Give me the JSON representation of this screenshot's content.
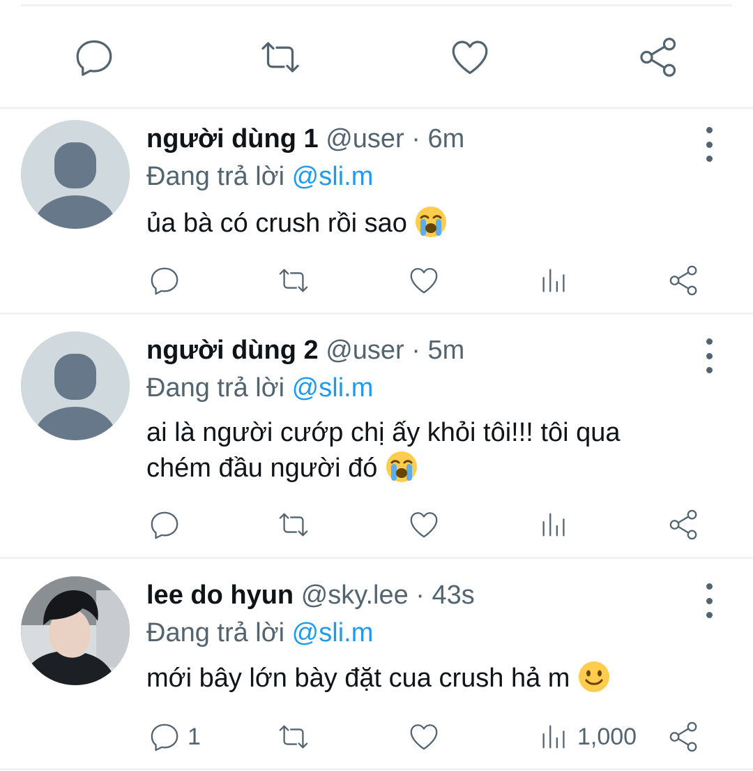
{
  "replying_prefix": "Đang trả lời",
  "icons": {
    "reply": "comment-bubble-icon",
    "retweet": "retweet-icon",
    "like": "heart-icon",
    "views": "bar-chart-icon",
    "share": "share-icon",
    "more": "more-vertical-icon"
  },
  "colors": {
    "accent": "#1d9bf0",
    "muted": "#536471",
    "divider": "#eff1f3"
  },
  "replies": [
    {
      "name": "người dùng 1",
      "handle": "@user",
      "dot": "·",
      "time": "6m",
      "replying_to": "@sli.m",
      "text": "ủa bà có crush rồi sao",
      "emoji": "loudly-crying-face",
      "reply_count": "",
      "views": ""
    },
    {
      "name": "người dùng 2",
      "handle": "@user",
      "dot": "·",
      "time": "5m",
      "replying_to": "@sli.m",
      "text": "ai là người cướp chị ấy khỏi tôi!!! tôi qua chém đầu người đó",
      "emoji": "loudly-crying-face",
      "reply_count": "",
      "views": ""
    },
    {
      "name": "lee do hyun",
      "handle": "@sky.lee",
      "dot": "·",
      "time": "43s",
      "replying_to": "@sli.m",
      "text": "mới bây lớn bày đặt cua crush hả m",
      "emoji": "slightly-smiling-face",
      "reply_count": "1",
      "views": "1,000"
    }
  ]
}
